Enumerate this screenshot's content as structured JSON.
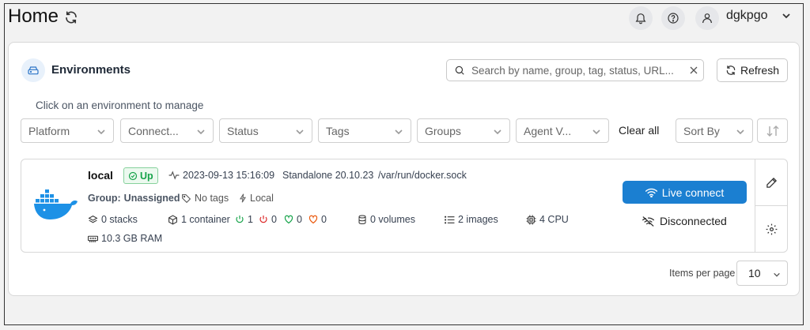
{
  "header": {
    "title": "Home",
    "username": "dgkpgo",
    "icons": [
      "refresh-icon",
      "bell-icon",
      "help-icon",
      "user-icon",
      "chevron-down-icon"
    ]
  },
  "environments": {
    "title": "Environments",
    "search_placeholder": "Search by name, group, tag, status, URL...",
    "refresh_label": "Refresh",
    "hint": "Click on an environment to manage",
    "filters": [
      "Platform",
      "Connect...",
      "Status",
      "Tags",
      "Groups",
      "Agent V..."
    ],
    "clear_all": "Clear all",
    "sort_by": "Sort By"
  },
  "env": {
    "name": "local",
    "status": "Up",
    "timestamp": "2023-09-13 15:16:09",
    "type_version": "Standalone 20.10.23",
    "socket": "/var/run/docker.sock",
    "group_label": "Group:",
    "group_value": "Unassigned",
    "tags": "No tags",
    "location": "Local",
    "stacks": "0 stacks",
    "containers": "1 container",
    "running": "1",
    "stopped": "0",
    "healthy": "0",
    "unhealthy": "0",
    "volumes": "0 volumes",
    "images": "2 images",
    "cpu": "4 CPU",
    "ram": "10.3 GB RAM",
    "live_connect": "Live connect",
    "disconnected": "Disconnected"
  },
  "pagination": {
    "items_per_page_label": "Items per page",
    "items_per_page_value": "10"
  },
  "colors": {
    "accent": "#1b7fd1",
    "docker": "#1d91e6",
    "up": "#16a34a",
    "stopped": "#dc2626",
    "unhealthy": "#ea580c"
  }
}
